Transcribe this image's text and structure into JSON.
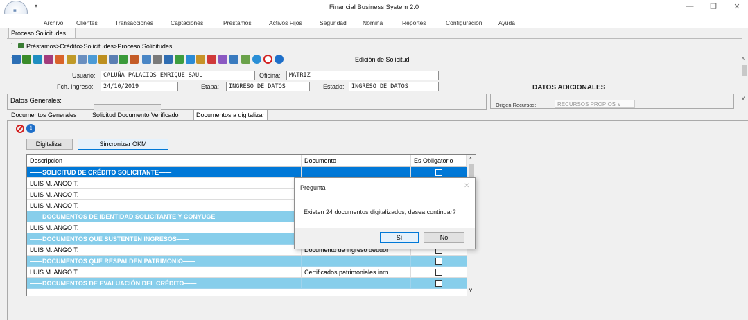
{
  "app": {
    "title": "Financial Business System 2.0",
    "logo_text": "FINANCIAL",
    "qa_arrow": "▾",
    "win_minimize": "—",
    "win_restore": "❐",
    "win_close": "✕"
  },
  "menu": [
    "Archivo",
    "Clientes",
    "Transacciones",
    "Captaciones",
    "Préstamos",
    "Activos Fijos",
    "Seguridad",
    "Nomina",
    "Reportes",
    "Configuración",
    "Ayuda"
  ],
  "doc_tab": "Proceso Solicitudes",
  "breadcrumb": "Préstamos>Crédito>Solicitudes>Proceso Solicitudes",
  "toolbar": {
    "label": "Edición de Solicitud",
    "icons": [
      "list-icon",
      "save-icon",
      "image-icon",
      "people-icon",
      "home-icon",
      "coins-icon",
      "document-icon",
      "edit-doc-icon",
      "sign-icon",
      "calc-icon",
      "tree-icon",
      "grid-icon",
      "edit-icon",
      "print-icon",
      "report-icon",
      "export-icon",
      "book-icon",
      "user-doc-icon",
      "transfer-icon",
      "magic-icon",
      "tools-icon",
      "note-icon",
      "globe-icon",
      "cancel-icon",
      "info-icon"
    ],
    "colors": [
      "#2c6fb5",
      "#3b8c2a",
      "#1f8ec1",
      "#a33c7c",
      "#d9632a",
      "#c09a28",
      "#6a8fbf",
      "#4c9bd6",
      "#bd8f1f",
      "#5b7fb3",
      "#3a9a3a",
      "#c45b26",
      "#4a86c5",
      "#7a7a7a",
      "#2f6db2",
      "#3e9d3e",
      "#2b8bd6",
      "#c79329",
      "#d03a3a",
      "#8b59c2",
      "#3a7bbf",
      "#6aa24a",
      "#2a8fd6",
      "#d21f1f",
      "#1e6fc9"
    ]
  },
  "user": {
    "usuario_label": "Usuario:",
    "usuario": "CALUÑA PALACIOS ENRIQUE SAUL",
    "oficina_label": "Oficina:",
    "oficina": "MATRIZ",
    "fch_label": "Fch. Ingreso:",
    "fch": "24/10/2019",
    "etapa_label": "Etapa:",
    "etapa": "INGRESO DE DATOS",
    "estado_label": "Estado:",
    "estado": "INGRESO DE DATOS"
  },
  "datos_adicionales": "DATOS ADICIONALES",
  "datos_generales": "Datos Generales:",
  "origen": {
    "label": "Origen Recursos:",
    "value": "RECURSOS PROPIOS ∨"
  },
  "tabs": [
    "Documentos Generales",
    "Solicitud Documento Verificado",
    "Documentos a digitalizar"
  ],
  "buttons": {
    "digitalizar": "Digitalizar",
    "sincronizar": "Sincronizar OKM"
  },
  "grid": {
    "headers": [
      "Descripcion",
      "Documento",
      "Es Obligatorio"
    ],
    "rows": [
      {
        "type": "sel",
        "desc": "——SOLICITUD DE CRÉDITO SOLICITANTE——",
        "doc": ""
      },
      {
        "type": "data",
        "desc": "LUIS M. ANGO T.",
        "doc": ""
      },
      {
        "type": "data",
        "desc": "LUIS M. ANGO T.",
        "doc": ""
      },
      {
        "type": "data",
        "desc": "LUIS M. ANGO T.",
        "doc": ""
      },
      {
        "type": "sec",
        "desc": "——DOCUMENTOS DE IDENTIDAD SOLICITANTE Y CONYUGE——",
        "doc": ""
      },
      {
        "type": "data",
        "desc": "LUIS M. ANGO T.",
        "doc": ""
      },
      {
        "type": "sec",
        "desc": "——DOCUMENTOS QUE SUSTENTEN INGRESOS——",
        "doc": ""
      },
      {
        "type": "data",
        "desc": "LUIS M. ANGO T.",
        "doc": "Documento de ingreso deudor"
      },
      {
        "type": "sec",
        "desc": "——DOCUMENTOS QUE RESPALDEN PATRIMONIO——",
        "doc": ""
      },
      {
        "type": "data",
        "desc": "LUIS M. ANGO T.",
        "doc": "Certificados patrimoniales inm..."
      },
      {
        "type": "sec",
        "desc": "——DOCUMENTOS DE EVALUACIÓN DEL CRÉDITO——",
        "doc": ""
      }
    ],
    "scroll_up": "^",
    "scroll_down": "v"
  },
  "dialog": {
    "title": "Pregunta",
    "close": "✕",
    "message": "Existen 24 documentos digitalizados, desea continuar?",
    "yes": "Sí",
    "no": "No"
  }
}
